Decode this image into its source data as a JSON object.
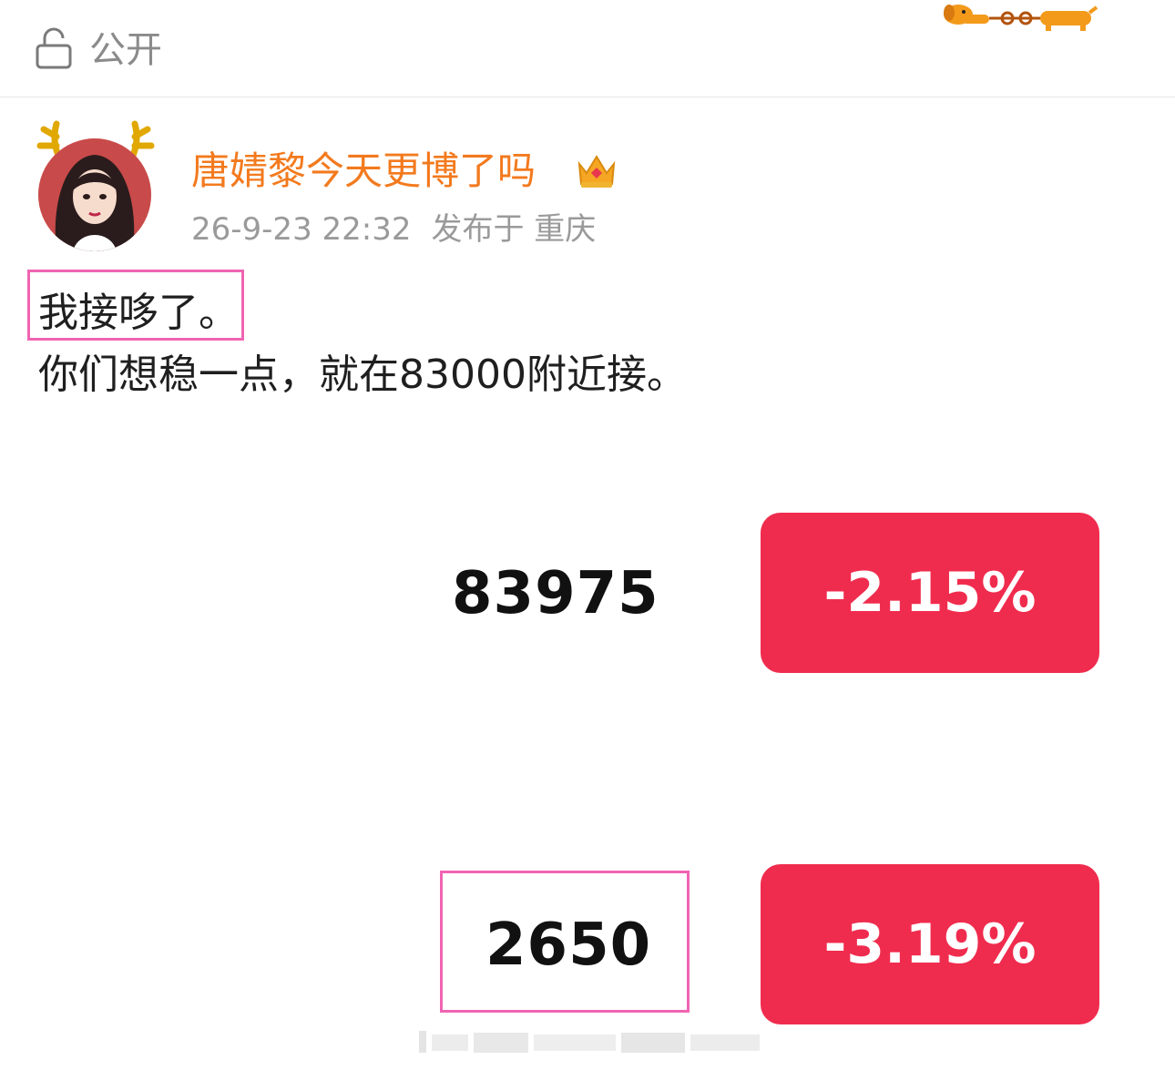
{
  "topbar": {
    "visibility_label": "公开",
    "lock_icon": "unlock-icon",
    "decor_icon": "dachshund-icon"
  },
  "post": {
    "username": "唐婧黎今天更博了吗",
    "badge_icon": "crown-icon",
    "time": "26-9-23 22:32",
    "location": "发布于 重庆",
    "text_line1": "我接哆了。",
    "text_line2": "你们想稳一点，就在83000附近接。"
  },
  "quotes": [
    {
      "price": "83975",
      "change": "-2.15%"
    },
    {
      "price": "2650",
      "change": "-3.19%"
    }
  ],
  "colors": {
    "username": "#f37a1e",
    "negative": "#f02c4e",
    "highlight": "#f064b2",
    "meta": "#9a9a9a"
  }
}
